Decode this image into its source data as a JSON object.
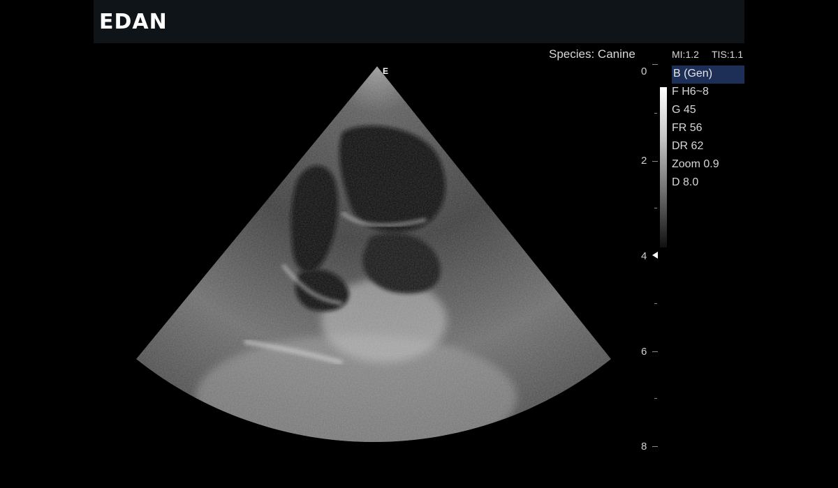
{
  "brand": "EDAN",
  "header": {
    "species": "Species: Canine",
    "mi": "MI:1.2",
    "tis": "TIS:1.1"
  },
  "imaging_params": {
    "mode": "B (Gen)",
    "frequency": "F H6~8",
    "gain": "G 45",
    "frame_rate": "FR 56",
    "dynamic_range": "DR 62",
    "zoom": "Zoom 0.9",
    "depth": "D 8.0"
  },
  "orientation_marker": "E",
  "depth_scale": {
    "labels": [
      "0",
      "2",
      "4",
      "6",
      "8"
    ],
    "focus_depth_cm": 4
  },
  "colors": {
    "background": "#000000",
    "topbar": "#0f1419",
    "mode_highlight": "#1d2f57",
    "text": "#d8d8d8"
  },
  "icons": {
    "focus_marker": "triangle-left-icon"
  }
}
